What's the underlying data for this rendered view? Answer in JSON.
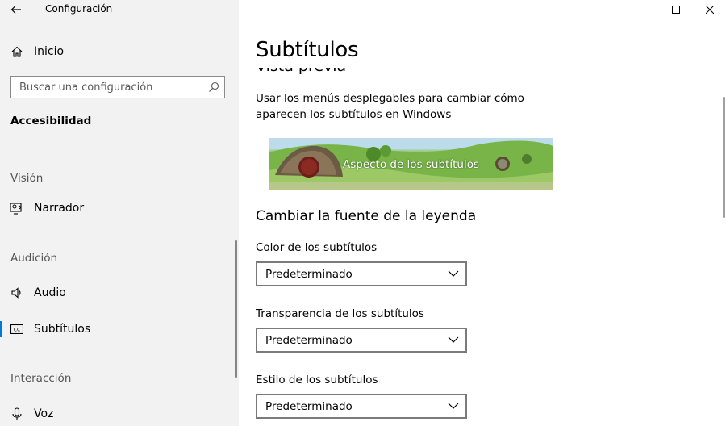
{
  "window": {
    "app_title": "Configuración"
  },
  "sidebar": {
    "home_label": "Inicio",
    "search": {
      "placeholder": "Buscar una configuración"
    },
    "current_section": "Accesibilidad",
    "groups": [
      {
        "header": "Visión",
        "items": [
          {
            "label": "Narrador",
            "icon": "narrator-icon"
          }
        ]
      },
      {
        "header": "Audición",
        "items": [
          {
            "label": "Audio",
            "icon": "speaker-icon"
          },
          {
            "label": "Subtítulos",
            "icon": "closed-captions-icon",
            "selected": true
          }
        ]
      },
      {
        "header": "Interacción",
        "items": [
          {
            "label": "Voz",
            "icon": "microphone-icon"
          }
        ]
      }
    ]
  },
  "main": {
    "title": "Subtítulos",
    "preview_heading": "Vista previa",
    "description": "Usar los menús desplegables para cambiar cómo aparecen los subtítulos en Windows",
    "preview_caption": "Aspecto de los subtítulos",
    "font_section_heading": "Cambiar la fuente de la leyenda",
    "fields": [
      {
        "label": "Color de los subtítulos",
        "value": "Predeterminado"
      },
      {
        "label": "Transparencia de los subtítulos",
        "value": "Predeterminado"
      },
      {
        "label": "Estilo de los subtítulos",
        "value": "Predeterminado"
      }
    ]
  },
  "colors": {
    "sidebar_bg": "#f2f2f2",
    "accent": "#0078d7",
    "dropdown_border": "#7a7a7a"
  }
}
